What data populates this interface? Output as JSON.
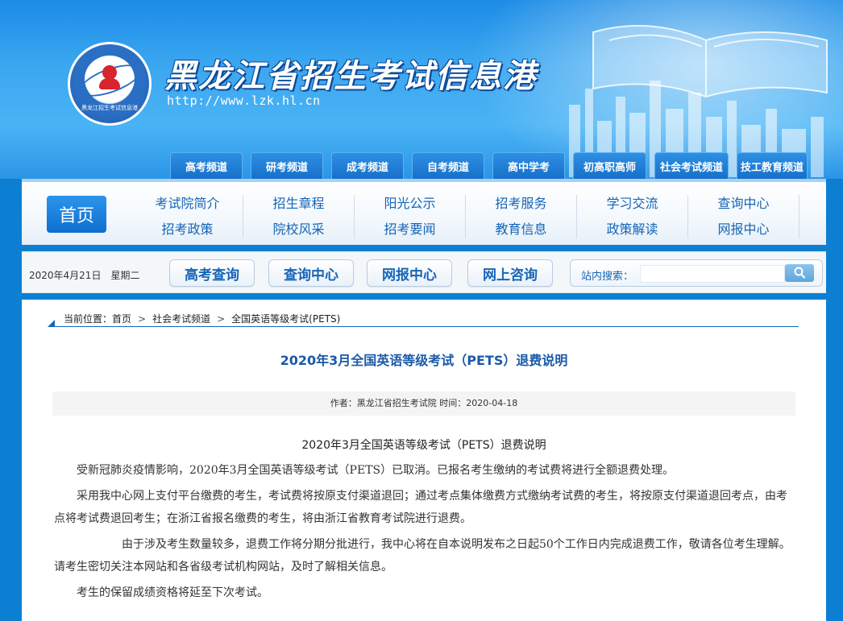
{
  "header": {
    "site_title": "黑龙江省招生考试信息港",
    "site_url": "http://www.lzk.hl.cn",
    "logo_text": "黑龙江招生考试信息港",
    "channel_tabs": [
      {
        "label": "高考频道"
      },
      {
        "label": "研考频道"
      },
      {
        "label": "成考频道"
      },
      {
        "label": "自考频道"
      },
      {
        "label": "高中学考"
      },
      {
        "label": "初高职高师"
      },
      {
        "label": "社会考试频道"
      },
      {
        "label": "技工教育频道"
      }
    ]
  },
  "nav": {
    "home_label": "首页",
    "groups": [
      {
        "top": "考试院简介",
        "bottom": "招考政策"
      },
      {
        "top": "招生章程",
        "bottom": "院校风采"
      },
      {
        "top": "阳光公示",
        "bottom": "招考要闻"
      },
      {
        "top": "招考服务",
        "bottom": "教育信息"
      },
      {
        "top": "学习交流",
        "bottom": "政策解读"
      },
      {
        "top": "查询中心",
        "bottom": "网报中心"
      }
    ]
  },
  "toolbar": {
    "date": "2020年4月21日　星期二",
    "buttons": [
      {
        "label": "高考查询"
      },
      {
        "label": "查询中心"
      },
      {
        "label": "网报中心"
      },
      {
        "label": "网上咨询"
      }
    ],
    "search_label": "站内搜索：",
    "search_value": ""
  },
  "breadcrumb": {
    "prefix": "当前位置：",
    "items": [
      "首页",
      "社会考试频道",
      "全国英语等级考试(PETS)"
    ],
    "separator": ">"
  },
  "article": {
    "title": "2020年3月全国英语等级考试（PETS）退费说明",
    "meta": "作者：黑龙江省招生考试院 时间：2020-04-18",
    "sub_title": "2020年3月全国英语等级考试（PETS）退费说明",
    "paragraphs": [
      "受新冠肺炎疫情影响，2020年3月全国英语等级考试（PETS）已取消。已报名考生缴纳的考试费将进行全额退费处理。",
      "采用我中心网上支付平台缴费的考生，考试费将按原支付渠道退回；通过考点集体缴费方式缴纳考试费的考生，将按原支付渠道退回考点，由考点将考试费退回考生；在浙江省报名缴费的考生，将由浙江省教育考试院进行退费。",
      "由于涉及考生数量较多，退费工作将分期分批进行，我中心将在自本说明发布之日起50个工作日内完成退费工作，敬请各位考生理解。请考生密切关注本网站和各省级考试机构网站，及时了解相关信息。",
      "考生的保留成绩资格将延至下次考试。"
    ]
  },
  "colors": {
    "brand_blue": "#1765b8",
    "header_blue": "#1b8be6",
    "title_blue": "#1a5aa8"
  }
}
